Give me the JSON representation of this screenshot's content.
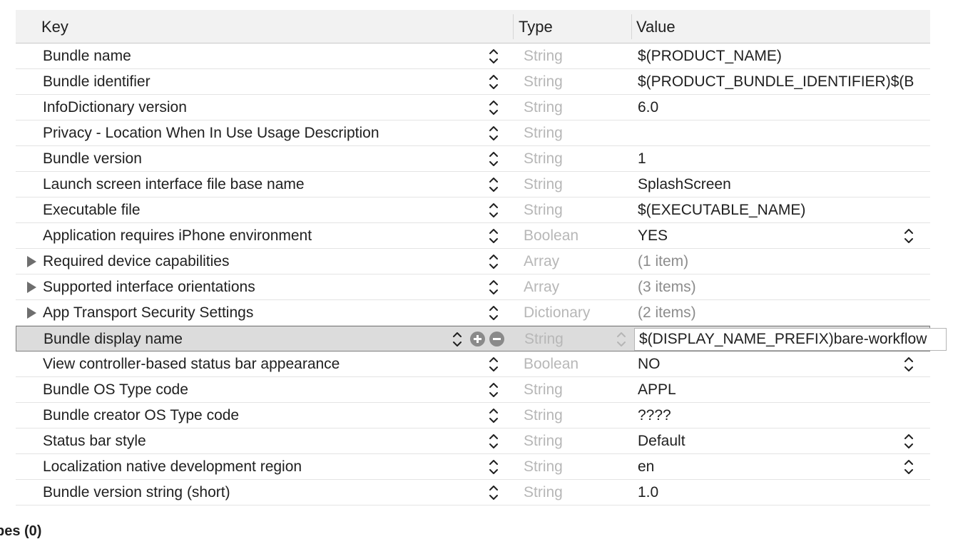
{
  "header": {
    "key": "Key",
    "type": "Type",
    "value": "Value"
  },
  "rows": [
    {
      "key": "Bundle name",
      "type": "String",
      "value": "$(PRODUCT_NAME)"
    },
    {
      "key": "Bundle identifier",
      "type": "String",
      "value": "$(PRODUCT_BUNDLE_IDENTIFIER)$(B"
    },
    {
      "key": "InfoDictionary version",
      "type": "String",
      "value": "6.0"
    },
    {
      "key": "Privacy - Location When In Use Usage Description",
      "type": "String",
      "value": ""
    },
    {
      "key": "Bundle version",
      "type": "String",
      "value": "1"
    },
    {
      "key": "Launch screen interface file base name",
      "type": "String",
      "value": "SplashScreen"
    },
    {
      "key": "Executable file",
      "type": "String",
      "value": "$(EXECUTABLE_NAME)"
    },
    {
      "key": "Application requires iPhone environment",
      "type": "Boolean",
      "value": "YES",
      "value_stepper": true
    },
    {
      "key": "Required device capabilities",
      "type": "Array",
      "value": "(1 item)",
      "expandable": true
    },
    {
      "key": "Supported interface orientations",
      "type": "Array",
      "value": "(3 items)",
      "expandable": true
    },
    {
      "key": "App Transport Security Settings",
      "type": "Dictionary",
      "value": "(2 items)",
      "expandable": true
    },
    {
      "key": "Bundle display name",
      "type": "String",
      "value": "$(DISPLAY_NAME_PREFIX)bare-workflow",
      "selected": true
    },
    {
      "key": "View controller-based status bar appearance",
      "type": "Boolean",
      "value": "NO",
      "value_stepper": true
    },
    {
      "key": "Bundle OS Type code",
      "type": "String",
      "value": "APPL"
    },
    {
      "key": "Bundle creator OS Type code",
      "type": "String",
      "value": "????"
    },
    {
      "key": "Status bar style",
      "type": "String",
      "value": "Default",
      "value_stepper": true
    },
    {
      "key": "Localization native development region",
      "type": "String",
      "value": "en",
      "value_stepper": true
    },
    {
      "key": "Bundle version string (short)",
      "type": "String",
      "value": "1.0"
    }
  ],
  "footer": {
    "heading": "pes (0)"
  }
}
